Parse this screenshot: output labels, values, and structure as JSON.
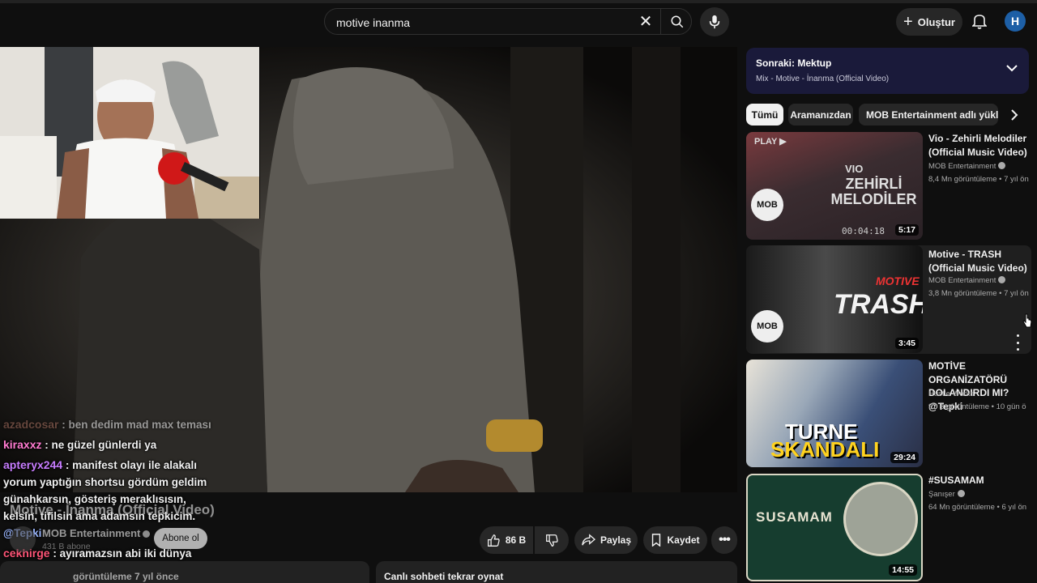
{
  "search": {
    "query": "motive inanma"
  },
  "header": {
    "create_label": "Oluştur",
    "avatar_letter": "H"
  },
  "chat": [
    {
      "user": "azadcosar",
      "sep": " : ",
      "text": "ben dedim mad max teması",
      "color": "#8a5a4a"
    },
    {
      "user": "kiraxxz",
      "sep": " : ",
      "text": "ne güzel günlerdi ya",
      "color": "#ff6ec7"
    },
    {
      "user": "apteryx244",
      "sep": " : ",
      "text": "manifest olayı ile alakalı yorum yaptığın shortsu gördüm geldim günahkarsın, gösteriş meraklısısın, kelsin, tifilsin ama adamsın tepkicim. ",
      "mention": "@Tepki",
      "color": "#c66bff"
    },
    {
      "user": "cekhirge",
      "sep": " : ",
      "text": "ayıramazsın abi iki dünya etle tırnak gibi",
      "color": "#ff4d6d"
    }
  ],
  "video": {
    "title": "Motive - İnanma (Official Video)",
    "channel": "MOB Entertainment",
    "subscribers": "431 B abone",
    "subscribe_label": "Abone ol",
    "likes": "86 B",
    "share_label": "Paylaş",
    "save_label": "Kaydet",
    "views_date": "görüntüleme  7 yıl önce",
    "replay_label": "Canlı sohbeti tekrar oynat"
  },
  "up_next": {
    "title": "Sonraki: Mektup",
    "subtitle": "Mix - Motive - İnanma (Official Video)"
  },
  "chips": [
    "Tümü",
    "Aramanızdan",
    "MOB Entertainment adlı yükleyici"
  ],
  "recommendations": [
    {
      "title": "Vio - Zehirli Melodiler (Official Music Video)",
      "channel": "MOB Entertainment",
      "meta": "8,4 Mn görüntüleme • 7 yıl ön",
      "duration": "5:17",
      "thumb_text": "ZEHİRLİ MELODİLER",
      "thumb_sub": "VIO",
      "thumb_time": "00:04:18",
      "thumb_badge": "PLAY ▶"
    },
    {
      "title": "Motive - TRASH (Official Music Video)",
      "channel": "MOB Entertainment",
      "meta": "3,8 Mn görüntüleme • 7 yıl ön",
      "duration": "3:45",
      "thumb_text": "TRASH",
      "thumb_sub": "MOTIVE"
    },
    {
      "title": "MOTİVE ORGANİZATÖRÜ DOLANDIRDI MI? @Tepki",
      "channel": "Hustle Works",
      "meta": "97 B görüntüleme • 10 gün ö",
      "duration": "29:24",
      "thumb_text": "TURNE",
      "thumb_sub": "SKANDALI"
    },
    {
      "title": "#SUSAMAM",
      "channel": "Şanışer",
      "meta": "64 Mn görüntüleme • 6 yıl ön",
      "duration": "14:55",
      "thumb_text": "SUSAMAM"
    }
  ]
}
